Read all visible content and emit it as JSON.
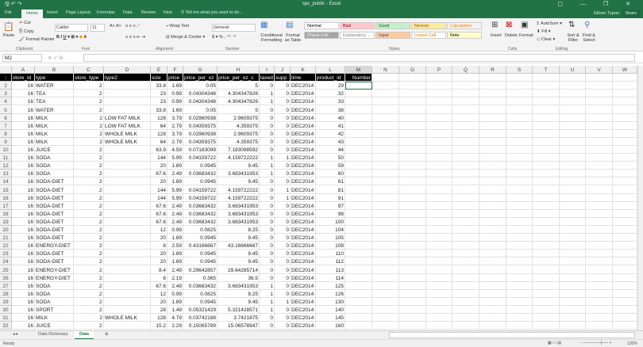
{
  "title": "sps_public - Excel",
  "user": "Eileen Typoe",
  "share": "Share",
  "ribbon_tabs": [
    "File",
    "Home",
    "Insert",
    "Page Layout",
    "Formulas",
    "Data",
    "Review",
    "View"
  ],
  "tell_me": "Tell me what you want to do...",
  "clipboard": {
    "paste": "Paste",
    "cut": "Cut",
    "copy": "Copy",
    "format_painter": "Format Painter",
    "label": "Clipboard"
  },
  "font": {
    "name": "Calibri",
    "size": "11",
    "label": "Font"
  },
  "alignment": {
    "wrap": "Wrap Text",
    "merge": "Merge & Center",
    "label": "Alignment"
  },
  "number": {
    "format": "General",
    "label": "Number"
  },
  "styles": {
    "cond": "Conditional Formatting",
    "table": "Format as Table",
    "label": "Styles",
    "items": [
      {
        "t": "Normal",
        "bg": "#ffffff",
        "c": "#000"
      },
      {
        "t": "Bad",
        "bg": "#ffc7ce",
        "c": "#9c0006"
      },
      {
        "t": "Good",
        "bg": "#c6efce",
        "c": "#006100"
      },
      {
        "t": "Neutral",
        "bg": "#ffeb9c",
        "c": "#9c5700"
      },
      {
        "t": "Calculation",
        "bg": "#f2f2f2",
        "c": "#fa7d00"
      },
      {
        "t": "Check Cell",
        "bg": "#a5a5a5",
        "c": "#fff"
      },
      {
        "t": "Explanatory ...",
        "bg": "#fff",
        "c": "#7f7f7f"
      },
      {
        "t": "Input",
        "bg": "#ffcc99",
        "c": "#3f3f76"
      },
      {
        "t": "Linked Cell",
        "bg": "#fff",
        "c": "#fa7d00"
      },
      {
        "t": "Note",
        "bg": "#ffffcc",
        "c": "#000"
      }
    ]
  },
  "cells": {
    "insert": "Insert",
    "delete": "Delete",
    "format": "Format",
    "label": "Cells"
  },
  "editing": {
    "autosum": "AutoSum",
    "fill": "Fill",
    "clear": "Clear",
    "sort": "Sort & Filter",
    "find": "Find & Select",
    "label": "Editing"
  },
  "name_box": "M2",
  "formula": "",
  "columns": [
    "A",
    "B",
    "C",
    "D",
    "E",
    "F",
    "G",
    "H",
    "I",
    "J",
    "K",
    "L",
    "M",
    "N",
    "O",
    "P",
    "Q",
    "R",
    "S",
    "T",
    "U",
    "V",
    "W"
  ],
  "headers": [
    "store_id",
    "type",
    "store_type",
    "type2",
    "size",
    "price",
    "price_per_oz",
    "price_per_oz_c",
    "taxed",
    "supp",
    "time",
    "product_id",
    "Number"
  ],
  "rows": [
    [
      "16",
      "WATER",
      "2",
      "",
      "33.8",
      "1.69",
      "0.05",
      "5",
      "0",
      "0",
      "DEC2014",
      "29"
    ],
    [
      "16",
      "TEA",
      "2",
      "",
      "23",
      "0.99",
      "0.04304348",
      "4.304347826",
      "1",
      "0",
      "DEC2014",
      "32"
    ],
    [
      "16",
      "TEA",
      "2",
      "",
      "23",
      "0.99",
      "0.04304348",
      "4.304347826",
      "1",
      "0",
      "DEC2014",
      "33"
    ],
    [
      "16",
      "WATER",
      "2",
      "",
      "33.8",
      "1.69",
      "0.05",
      "5",
      "0",
      "0",
      "DEC2014",
      "38"
    ],
    [
      "16",
      "MILK",
      "2",
      "LOW FAT MILK",
      "128",
      "3.79",
      "0.02960938",
      "2.9609375",
      "0",
      "0",
      "DEC2014",
      "40"
    ],
    [
      "16",
      "MILK",
      "2",
      "LOW FAT MILK",
      "64",
      "2.79",
      "0.04359375",
      "4.359375",
      "0",
      "0",
      "DEC2014",
      "41"
    ],
    [
      "16",
      "MILK",
      "2",
      "WHOLE MILK",
      "128",
      "3.79",
      "0.02960938",
      "2.9609375",
      "0",
      "0",
      "DEC2014",
      "42"
    ],
    [
      "16",
      "MILK",
      "2",
      "WHOLE MILK",
      "64",
      "2.79",
      "0.04359375",
      "4.359375",
      "0",
      "0",
      "DEC2014",
      "43"
    ],
    [
      "16",
      "JUICE",
      "2",
      "",
      "63.9",
      "4.59",
      "0.07183099",
      "7.183098592",
      "0",
      "0",
      "DEC2014",
      "44"
    ],
    [
      "16",
      "SODA",
      "2",
      "",
      "144",
      "5.99",
      "0.04159722",
      "4.159722222",
      "1",
      "1",
      "DEC2014",
      "50"
    ],
    [
      "16",
      "SODA",
      "2",
      "",
      "20",
      "1.89",
      "0.0945",
      "9.45",
      "1",
      "0",
      "DEC2014",
      "59"
    ],
    [
      "16",
      "SODA",
      "2",
      "",
      "67.6",
      "2.49",
      "0.03683432",
      "3.683431953",
      "1",
      "0",
      "DEC2014",
      "60"
    ],
    [
      "16",
      "SODA-DIET",
      "2",
      "",
      "20",
      "1.89",
      "0.0945",
      "9.45",
      "0",
      "0",
      "DEC2014",
      "61"
    ],
    [
      "16",
      "SODA-DIET",
      "2",
      "",
      "144",
      "5.99",
      "0.04159722",
      "4.159722222",
      "0",
      "1",
      "DEC2014",
      "81"
    ],
    [
      "16",
      "SODA-DIET",
      "2",
      "",
      "144",
      "5.99",
      "0.04159722",
      "4.159722222",
      "0",
      "1",
      "DEC2014",
      "91"
    ],
    [
      "16",
      "SODA-DIET",
      "2",
      "",
      "67.6",
      "2.49",
      "0.03683432",
      "3.683431953",
      "0",
      "0",
      "DEC2014",
      "97"
    ],
    [
      "16",
      "SODA-DIET",
      "2",
      "",
      "67.6",
      "2.49",
      "0.03683432",
      "3.683431953",
      "0",
      "0",
      "DEC2014",
      "98"
    ],
    [
      "16",
      "SODA-DIET",
      "2",
      "",
      "67.6",
      "2.49",
      "0.03683432",
      "3.683431953",
      "0",
      "0",
      "DEC2014",
      "100"
    ],
    [
      "16",
      "SODA-DIET",
      "2",
      "",
      "12",
      "0.99",
      "0.0825",
      "8.25",
      "0",
      "0",
      "DEC2014",
      "104"
    ],
    [
      "16",
      "SODA-DIET",
      "2",
      "",
      "20",
      "1.89",
      "0.0945",
      "9.45",
      "0",
      "0",
      "DEC2014",
      "105"
    ],
    [
      "16",
      "ENERGY-DIET",
      "2",
      "",
      "6",
      "2.59",
      "0.43166667",
      "43.16666667",
      "0",
      "0",
      "DEC2014",
      "108"
    ],
    [
      "16",
      "SODA-DIET",
      "2",
      "",
      "20",
      "1.89",
      "0.0945",
      "9.45",
      "0",
      "0",
      "DEC2014",
      "110"
    ],
    [
      "16",
      "SODA-DIET",
      "2",
      "",
      "20",
      "1.89",
      "0.0945",
      "9.45",
      "0",
      "0",
      "DEC2014",
      "112"
    ],
    [
      "16",
      "ENERGY-DIET",
      "2",
      "",
      "8.4",
      "2.49",
      "0.29642857",
      "29.64285714",
      "0",
      "0",
      "DEC2014",
      "113"
    ],
    [
      "16",
      "ENERGY-DIET",
      "2",
      "",
      "6",
      "2.19",
      "0.365",
      "36.5",
      "0",
      "0",
      "DEC2014",
      "114"
    ],
    [
      "16",
      "SODA",
      "2",
      "",
      "67.6",
      "2.49",
      "0.03683432",
      "3.683431953",
      "1",
      "0",
      "DEC2014",
      "125"
    ],
    [
      "16",
      "SODA",
      "2",
      "",
      "12",
      "0.99",
      "0.0825",
      "8.25",
      "1",
      "0",
      "DEC2014",
      "126"
    ],
    [
      "16",
      "SODA",
      "2",
      "",
      "20",
      "1.89",
      "0.0945",
      "9.45",
      "1",
      "1",
      "DEC2014",
      "130"
    ],
    [
      "16",
      "SPORT",
      "2",
      "",
      "28",
      "1.49",
      "0.05321429",
      "5.321428571",
      "1",
      "0",
      "DEC2014",
      "140"
    ],
    [
      "16",
      "MILK",
      "2",
      "WHOLE MILK",
      "128",
      "4.79",
      "0.03742188",
      "3.7421875",
      "0",
      "0",
      "DEC2014",
      "145"
    ],
    [
      "16",
      "JUICE",
      "2",
      "",
      "15.2",
      "2.29",
      "0.15065789",
      "15.06578947",
      "0",
      "0",
      "DEC2014",
      "160"
    ]
  ],
  "sheets": [
    "Data Dictionary",
    "Data"
  ],
  "active_sheet": "Data",
  "status": "Ready",
  "zoom": "120%",
  "accent": "#217346"
}
